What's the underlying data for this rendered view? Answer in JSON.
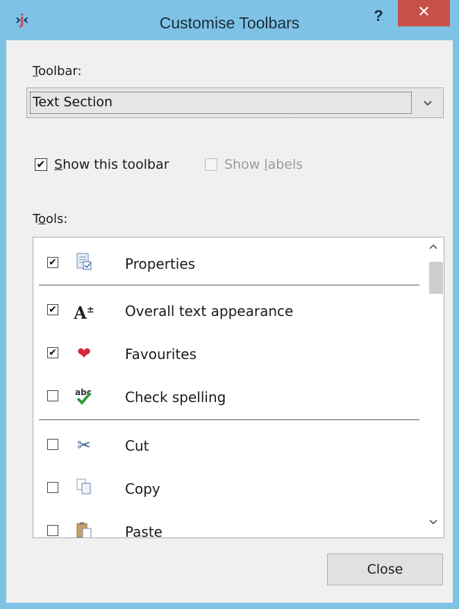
{
  "window": {
    "title": "Customise Toolbars",
    "help_label": "?",
    "close_label": "✕",
    "app_icon": "app-logo-icon"
  },
  "toolbar_section": {
    "label_underlined": "T",
    "label_rest": "oolbar:",
    "selected": "Text Section"
  },
  "options": {
    "show_toolbar": {
      "u": "S",
      "rest": "how this toolbar",
      "checked": true
    },
    "show_labels": {
      "pre": "Show ",
      "u": "l",
      "rest": "abels",
      "checked": false,
      "disabled": true
    }
  },
  "tools_section": {
    "label_pre": "T",
    "label_u": "o",
    "label_rest": "ols:"
  },
  "tools": [
    {
      "label": "Properties",
      "checked": true,
      "icon": "properties-icon"
    },
    {
      "label": "Overall text appearance",
      "checked": true,
      "icon": "text-appearance-icon"
    },
    {
      "label": "Favourites",
      "checked": true,
      "icon": "heart-icon"
    },
    {
      "label": "Check spelling",
      "checked": false,
      "icon": "spellcheck-icon"
    },
    {
      "label": "Cut",
      "checked": false,
      "icon": "scissors-icon"
    },
    {
      "label": "Copy",
      "checked": false,
      "icon": "copy-icon"
    },
    {
      "label": "Paste",
      "checked": false,
      "icon": "paste-icon"
    }
  ],
  "glyphs": {
    "check": "✔",
    "text_icon": "A",
    "text_icon_sup": "±",
    "heart": "❤",
    "abc": "abc",
    "scissors": "✂",
    "dropdown_arrow": "⌄",
    "scroll_up": "⌃",
    "scroll_down": "⌄",
    "app_logo": "ʲ"
  },
  "buttons": {
    "close": "Close"
  }
}
